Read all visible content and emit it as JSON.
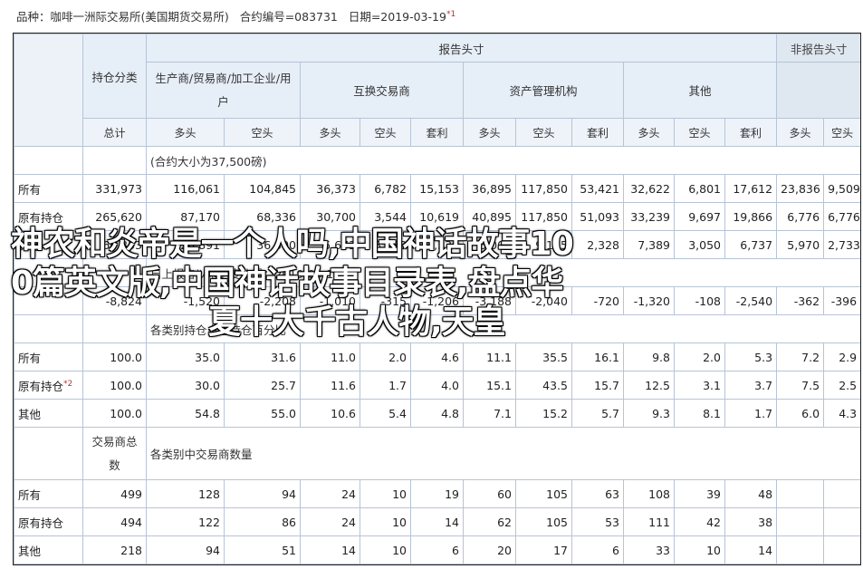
{
  "header": {
    "product": "品种：咖啡一洲际交易所(美国期货交易所)",
    "code": "合约编号=083731",
    "date": "日期=2019-03-19",
    "note_mark": "*1"
  },
  "table": {
    "reporting_header": "报告头寸",
    "nonreporting_header": "非报告头寸",
    "position_class": "持仓分类",
    "total": "总计",
    "groups": [
      "生产商/贸易商/加工企业/用户",
      "互换交易商",
      "资产管理机构",
      "其他"
    ],
    "sub_long": "多头",
    "sub_short": "空头",
    "sub_spread": "套利",
    "note_contract": "(合约大小为37,500磅)",
    "rows_a": [
      {
        "label": "所有",
        "values": [
          "331,973",
          "116,061",
          "104,845",
          "36,373",
          "6,782",
          "15,153",
          "36,895",
          "117,850",
          "53,421",
          "32,622",
          "6,801",
          "17,612",
          "23,836",
          "9,509"
        ]
      },
      {
        "label": "原有持仓",
        "values": [
          "265,620",
          "87,170",
          "68,336",
          "30,700",
          "3,544",
          "10,619",
          "40,895",
          "117,850",
          "51,093",
          "33,239",
          "9,697",
          "19,866",
          "6,776",
          "6,776"
        ]
      },
      {
        "label": "其他",
        "values": [
          "66,353",
          "28,891",
          "36,500",
          "5,673",
          "3,238",
          "4,534",
          "6,000",
          "9,125",
          "2,328",
          "7,389",
          "3,050",
          "6,737",
          "5,970",
          "2,733"
        ]
      }
    ],
    "note_change": "自上报告以来的变化量：2019-03-12",
    "change_row": {
      "label": "",
      "values": [
        "-8,824",
        "-1,520",
        "-2,208",
        "-1,010",
        "-315",
        "-1,206",
        "-3,188",
        "-2,040",
        "-720",
        "-1,320",
        "-108",
        "-2,540",
        "-362",
        "-396"
      ]
    },
    "note_percent": "各类别持仓占总持仓百分比",
    "percent_rows": [
      {
        "label": "所有",
        "mark": "",
        "values": [
          "100.0",
          "35.0",
          "31.6",
          "11.0",
          "2.0",
          "4.6",
          "11.1",
          "35.5",
          "16.1",
          "9.8",
          "2.0",
          "5.3",
          "7.2",
          "2.9"
        ]
      },
      {
        "label": "原有持仓",
        "mark": "*2",
        "values": [
          "100.0",
          "30.0",
          "25.7",
          "11.6",
          "1.7",
          "4.0",
          "15.1",
          "43.5",
          "15.7",
          "12.5",
          "3.1",
          "3.7",
          "7.5",
          "2.5"
        ]
      },
      {
        "label": "其他",
        "mark": "",
        "values": [
          "100.0",
          "54.8",
          "55.0",
          "10.6",
          "5.4",
          "4.8",
          "7.1",
          "15.2",
          "5.7",
          "9.3",
          "8.1",
          "1.7",
          "6.0",
          "4.3"
        ]
      }
    ],
    "trader_total_line1": "交易商总",
    "trader_total_line2": "数",
    "note_traders": "各类别中交易商数量",
    "trader_rows": [
      {
        "label": "所有",
        "values": [
          "499",
          "128",
          "94",
          "24",
          "10",
          "19",
          "60",
          "105",
          "63",
          "108",
          "39",
          "48",
          "",
          ""
        ]
      },
      {
        "label": "原有持仓",
        "values": [
          "494",
          "122",
          "86",
          "24",
          "10",
          "14",
          "62",
          "105",
          "53",
          "111",
          "42",
          "38",
          "",
          ""
        ]
      },
      {
        "label": "其他",
        "values": [
          "218",
          "94",
          "51",
          "14",
          "10",
          "6",
          "20",
          "17",
          "6",
          "33",
          "10",
          "14",
          "",
          ""
        ]
      }
    ]
  },
  "overlay": {
    "line1": "神农和炎帝是一个人吗,中国神话故事10",
    "line2": "0篇英文版,中国神话故事目录表,盘点华",
    "line3": "夏十大千古人物,天皇"
  }
}
